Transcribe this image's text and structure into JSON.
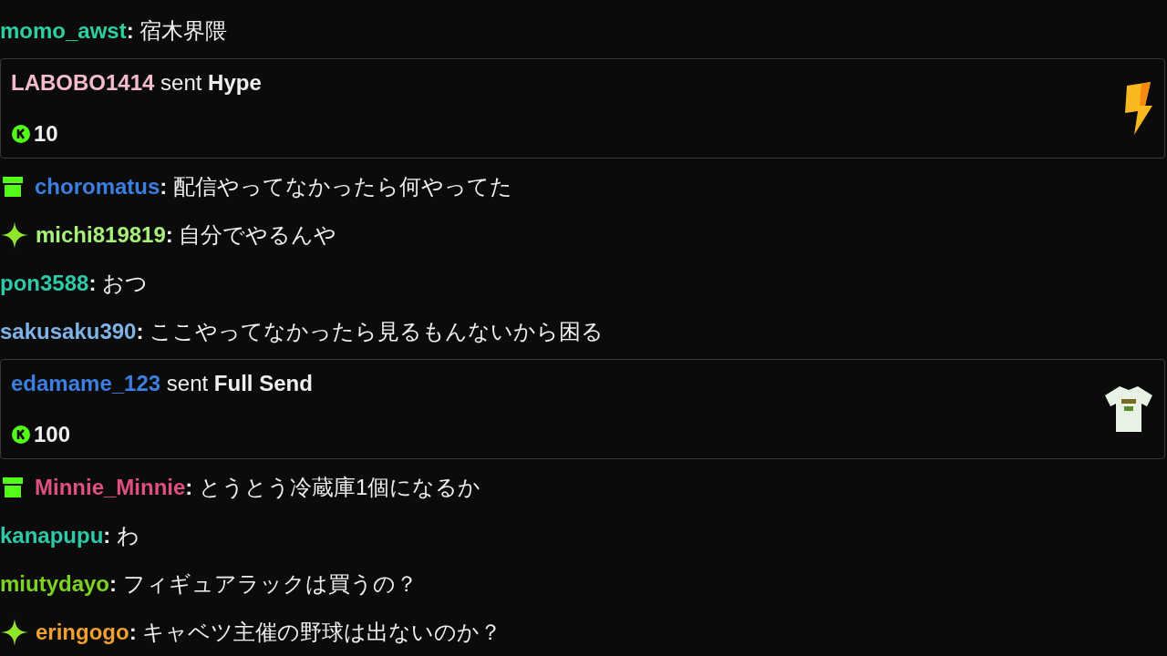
{
  "chat": [
    {
      "kind": "plain",
      "user": "momo_awst",
      "color": "#2ecfa0",
      "separator": ":",
      "text": "宿木界隈"
    },
    {
      "kind": "hype",
      "user": "LABOBO1414",
      "color": "#f4bccb",
      "verb": "sent",
      "item": "Hype",
      "amount": "10"
    },
    {
      "kind": "gifter",
      "user": "choromatus",
      "color": "#3d7fe0",
      "separator": ":",
      "text": "配信やってなかったら何やってた"
    },
    {
      "kind": "sparkle",
      "user": "michi819819",
      "color": "#a8f07c",
      "separator": ":",
      "text": "自分でやるんや"
    },
    {
      "kind": "plain",
      "user": "pon3588",
      "color": "#2ec9a8",
      "separator": ":",
      "text": "おつ"
    },
    {
      "kind": "plain",
      "user": "sakusaku390",
      "color": "#7fb3e8",
      "separator": ":",
      "text": "ここやってなかったら見るもんないから困る"
    },
    {
      "kind": "shirt",
      "user": "edamame_123",
      "color": "#3d7fe0",
      "verb": "sent",
      "item": "Full Send",
      "amount": "100"
    },
    {
      "kind": "gifter",
      "user": "Minnie_Minnie",
      "color": "#e0507e",
      "separator": ":",
      "text": "とうとう冷蔵庫1個になるか"
    },
    {
      "kind": "plain",
      "user": "kanapupu",
      "color": "#2ec9a8",
      "separator": ":",
      "text": "わ"
    },
    {
      "kind": "plain",
      "user": "miutydayo",
      "color": "#7ed321",
      "separator": ":",
      "text": "フィギュアラックは買うの？"
    },
    {
      "kind": "sparkle",
      "user": "eringogo",
      "color": "#f0a030",
      "separator": ":",
      "text": "キャベツ主催の野球は出ないのか？"
    }
  ]
}
